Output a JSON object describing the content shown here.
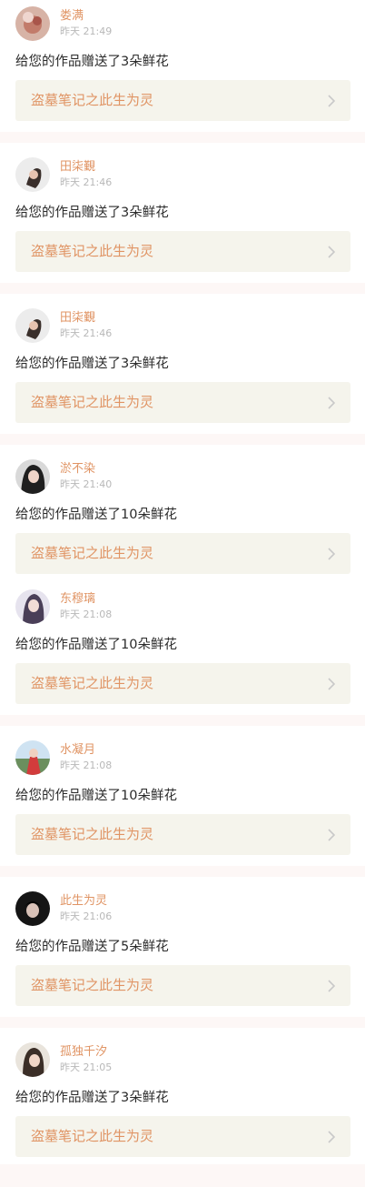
{
  "gifts": [
    {
      "user": "娄满",
      "time": "昨天 21:49",
      "message": "给您的作品赠送了3朵鲜花",
      "work": "盗墓笔记之此生为灵",
      "avatar": "avatar-user-1"
    },
    {
      "user": "田柒覲",
      "time": "昨天 21:46",
      "message": "给您的作品赠送了3朵鲜花",
      "work": "盗墓笔记之此生为灵",
      "avatar": "avatar-user-2"
    },
    {
      "user": "田柒覲",
      "time": "昨天 21:46",
      "message": "给您的作品赠送了3朵鲜花",
      "work": "盗墓笔记之此生为灵",
      "avatar": "avatar-user-2"
    },
    {
      "user": "淤不染",
      "time": "昨天 21:40",
      "message": "给您的作品赠送了10朵鲜花",
      "work": "盗墓笔记之此生为灵",
      "avatar": "avatar-user-3"
    },
    {
      "user": "东穆璃",
      "time": "昨天 21:08",
      "message": "给您的作品赠送了10朵鲜花",
      "work": "盗墓笔记之此生为灵",
      "avatar": "avatar-user-4"
    },
    {
      "user": "水凝月",
      "time": "昨天 21:08",
      "message": "给您的作品赠送了10朵鲜花",
      "work": "盗墓笔记之此生为灵",
      "avatar": "avatar-user-5"
    },
    {
      "user": "此生为灵",
      "time": "昨天 21:06",
      "message": "给您的作品赠送了5朵鲜花",
      "work": "盗墓笔记之此生为灵",
      "avatar": "avatar-user-6"
    },
    {
      "user": "孤独千汐",
      "time": "昨天 21:05",
      "message": "给您的作品赠送了3朵鲜花",
      "work": "盗墓笔记之此生为灵",
      "avatar": "avatar-user-7"
    }
  ],
  "colors": {
    "accent": "#e09464",
    "work_bg": "#f5f4ec",
    "timestamp": "#b8b8b8",
    "divider": "#fdf7f6"
  },
  "icons": {
    "work_link": "chevron-right-icon"
  }
}
